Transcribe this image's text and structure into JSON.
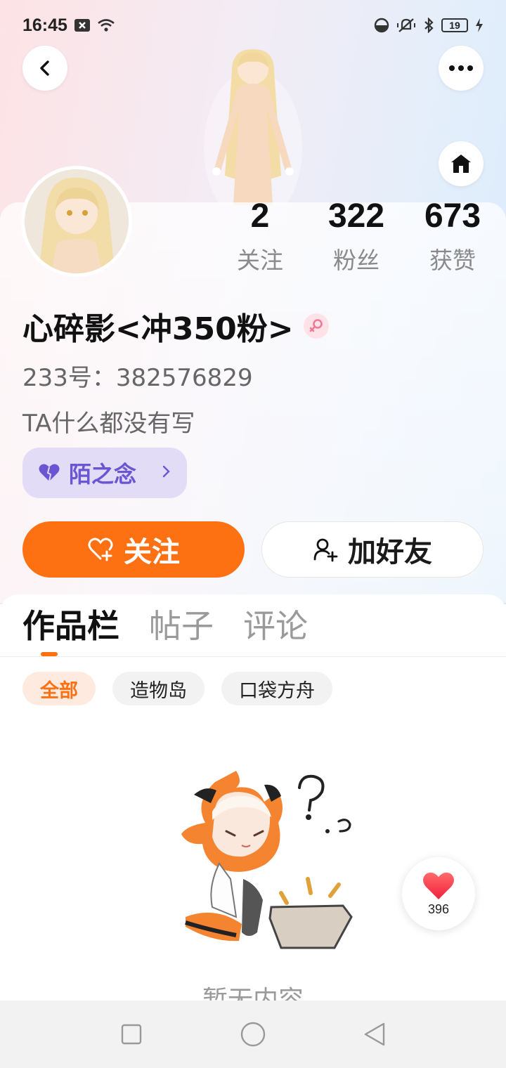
{
  "status_bar": {
    "time": "16:45",
    "battery": "19",
    "icons": [
      "notification-x-icon",
      "wifi-icon",
      "data-saver-icon",
      "vibrate-icon",
      "bluetooth-icon",
      "battery-icon",
      "charging-icon"
    ]
  },
  "header": {
    "back_icon": "chevron-left-icon",
    "more_icon": "more-dots-icon",
    "home_icon": "home-icon"
  },
  "profile": {
    "username": "心碎影<冲350粉>",
    "gender_icon": "female-icon",
    "uid": "233号：382576829",
    "bio": "TA什么都没有写",
    "tag_label": "陌之念",
    "tag_icon": "heart-icon"
  },
  "stats": [
    {
      "value": "2",
      "label": "关注"
    },
    {
      "value": "322",
      "label": "粉丝"
    },
    {
      "value": "673",
      "label": "获赞"
    }
  ],
  "actions": {
    "follow_label": "关注",
    "add_friend_label": "加好友"
  },
  "tabs": [
    {
      "label": "作品栏",
      "active": true
    },
    {
      "label": "帖子",
      "active": false
    },
    {
      "label": "评论",
      "active": false
    }
  ],
  "filters": [
    {
      "label": "全部",
      "active": true
    },
    {
      "label": "造物岛",
      "active": false
    },
    {
      "label": "口袋方舟",
      "active": false
    }
  ],
  "empty_state": {
    "text": "暂无内容"
  },
  "like_fab": {
    "count": "396"
  },
  "colors": {
    "accent": "#fe7113",
    "tag_bg": "#e3dcf6",
    "tag_text": "#6a55d3"
  }
}
